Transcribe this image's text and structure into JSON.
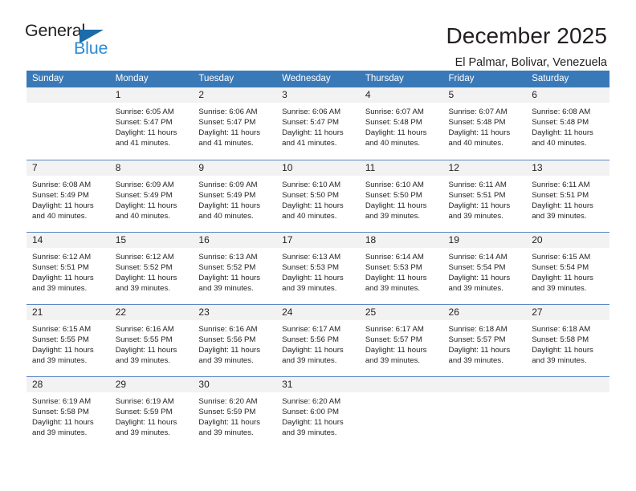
{
  "brand": {
    "name_top": "General",
    "name_bottom": "Blue",
    "triangle_color": "#1b6ca8",
    "bottom_color": "#2e8bd4"
  },
  "header": {
    "title": "December 2025",
    "location": "El Palmar, Bolivar, Venezuela"
  },
  "theme": {
    "header_row_bg": "#3a79b8",
    "daynum_bg": "#f2f2f2",
    "grid_line": "#5b87c5",
    "text": "#231f20"
  },
  "weekday_headers": [
    "Sunday",
    "Monday",
    "Tuesday",
    "Wednesday",
    "Thursday",
    "Friday",
    "Saturday"
  ],
  "labels": {
    "sunrise_prefix": "Sunrise:",
    "sunset_prefix": "Sunset:",
    "daylight_prefix": "Daylight:"
  },
  "weeks": [
    [
      {
        "day": "",
        "blank": true
      },
      {
        "day": "1",
        "sunrise": "Sunrise: 6:05 AM",
        "sunset": "Sunset: 5:47 PM",
        "daylight_1": "Daylight: 11 hours",
        "daylight_2": "and 41 minutes."
      },
      {
        "day": "2",
        "sunrise": "Sunrise: 6:06 AM",
        "sunset": "Sunset: 5:47 PM",
        "daylight_1": "Daylight: 11 hours",
        "daylight_2": "and 41 minutes."
      },
      {
        "day": "3",
        "sunrise": "Sunrise: 6:06 AM",
        "sunset": "Sunset: 5:47 PM",
        "daylight_1": "Daylight: 11 hours",
        "daylight_2": "and 41 minutes."
      },
      {
        "day": "4",
        "sunrise": "Sunrise: 6:07 AM",
        "sunset": "Sunset: 5:48 PM",
        "daylight_1": "Daylight: 11 hours",
        "daylight_2": "and 40 minutes."
      },
      {
        "day": "5",
        "sunrise": "Sunrise: 6:07 AM",
        "sunset": "Sunset: 5:48 PM",
        "daylight_1": "Daylight: 11 hours",
        "daylight_2": "and 40 minutes."
      },
      {
        "day": "6",
        "sunrise": "Sunrise: 6:08 AM",
        "sunset": "Sunset: 5:48 PM",
        "daylight_1": "Daylight: 11 hours",
        "daylight_2": "and 40 minutes."
      }
    ],
    [
      {
        "day": "7",
        "sunrise": "Sunrise: 6:08 AM",
        "sunset": "Sunset: 5:49 PM",
        "daylight_1": "Daylight: 11 hours",
        "daylight_2": "and 40 minutes."
      },
      {
        "day": "8",
        "sunrise": "Sunrise: 6:09 AM",
        "sunset": "Sunset: 5:49 PM",
        "daylight_1": "Daylight: 11 hours",
        "daylight_2": "and 40 minutes."
      },
      {
        "day": "9",
        "sunrise": "Sunrise: 6:09 AM",
        "sunset": "Sunset: 5:49 PM",
        "daylight_1": "Daylight: 11 hours",
        "daylight_2": "and 40 minutes."
      },
      {
        "day": "10",
        "sunrise": "Sunrise: 6:10 AM",
        "sunset": "Sunset: 5:50 PM",
        "daylight_1": "Daylight: 11 hours",
        "daylight_2": "and 40 minutes."
      },
      {
        "day": "11",
        "sunrise": "Sunrise: 6:10 AM",
        "sunset": "Sunset: 5:50 PM",
        "daylight_1": "Daylight: 11 hours",
        "daylight_2": "and 39 minutes."
      },
      {
        "day": "12",
        "sunrise": "Sunrise: 6:11 AM",
        "sunset": "Sunset: 5:51 PM",
        "daylight_1": "Daylight: 11 hours",
        "daylight_2": "and 39 minutes."
      },
      {
        "day": "13",
        "sunrise": "Sunrise: 6:11 AM",
        "sunset": "Sunset: 5:51 PM",
        "daylight_1": "Daylight: 11 hours",
        "daylight_2": "and 39 minutes."
      }
    ],
    [
      {
        "day": "14",
        "sunrise": "Sunrise: 6:12 AM",
        "sunset": "Sunset: 5:51 PM",
        "daylight_1": "Daylight: 11 hours",
        "daylight_2": "and 39 minutes."
      },
      {
        "day": "15",
        "sunrise": "Sunrise: 6:12 AM",
        "sunset": "Sunset: 5:52 PM",
        "daylight_1": "Daylight: 11 hours",
        "daylight_2": "and 39 minutes."
      },
      {
        "day": "16",
        "sunrise": "Sunrise: 6:13 AM",
        "sunset": "Sunset: 5:52 PM",
        "daylight_1": "Daylight: 11 hours",
        "daylight_2": "and 39 minutes."
      },
      {
        "day": "17",
        "sunrise": "Sunrise: 6:13 AM",
        "sunset": "Sunset: 5:53 PM",
        "daylight_1": "Daylight: 11 hours",
        "daylight_2": "and 39 minutes."
      },
      {
        "day": "18",
        "sunrise": "Sunrise: 6:14 AM",
        "sunset": "Sunset: 5:53 PM",
        "daylight_1": "Daylight: 11 hours",
        "daylight_2": "and 39 minutes."
      },
      {
        "day": "19",
        "sunrise": "Sunrise: 6:14 AM",
        "sunset": "Sunset: 5:54 PM",
        "daylight_1": "Daylight: 11 hours",
        "daylight_2": "and 39 minutes."
      },
      {
        "day": "20",
        "sunrise": "Sunrise: 6:15 AM",
        "sunset": "Sunset: 5:54 PM",
        "daylight_1": "Daylight: 11 hours",
        "daylight_2": "and 39 minutes."
      }
    ],
    [
      {
        "day": "21",
        "sunrise": "Sunrise: 6:15 AM",
        "sunset": "Sunset: 5:55 PM",
        "daylight_1": "Daylight: 11 hours",
        "daylight_2": "and 39 minutes."
      },
      {
        "day": "22",
        "sunrise": "Sunrise: 6:16 AM",
        "sunset": "Sunset: 5:55 PM",
        "daylight_1": "Daylight: 11 hours",
        "daylight_2": "and 39 minutes."
      },
      {
        "day": "23",
        "sunrise": "Sunrise: 6:16 AM",
        "sunset": "Sunset: 5:56 PM",
        "daylight_1": "Daylight: 11 hours",
        "daylight_2": "and 39 minutes."
      },
      {
        "day": "24",
        "sunrise": "Sunrise: 6:17 AM",
        "sunset": "Sunset: 5:56 PM",
        "daylight_1": "Daylight: 11 hours",
        "daylight_2": "and 39 minutes."
      },
      {
        "day": "25",
        "sunrise": "Sunrise: 6:17 AM",
        "sunset": "Sunset: 5:57 PM",
        "daylight_1": "Daylight: 11 hours",
        "daylight_2": "and 39 minutes."
      },
      {
        "day": "26",
        "sunrise": "Sunrise: 6:18 AM",
        "sunset": "Sunset: 5:57 PM",
        "daylight_1": "Daylight: 11 hours",
        "daylight_2": "and 39 minutes."
      },
      {
        "day": "27",
        "sunrise": "Sunrise: 6:18 AM",
        "sunset": "Sunset: 5:58 PM",
        "daylight_1": "Daylight: 11 hours",
        "daylight_2": "and 39 minutes."
      }
    ],
    [
      {
        "day": "28",
        "sunrise": "Sunrise: 6:19 AM",
        "sunset": "Sunset: 5:58 PM",
        "daylight_1": "Daylight: 11 hours",
        "daylight_2": "and 39 minutes."
      },
      {
        "day": "29",
        "sunrise": "Sunrise: 6:19 AM",
        "sunset": "Sunset: 5:59 PM",
        "daylight_1": "Daylight: 11 hours",
        "daylight_2": "and 39 minutes."
      },
      {
        "day": "30",
        "sunrise": "Sunrise: 6:20 AM",
        "sunset": "Sunset: 5:59 PM",
        "daylight_1": "Daylight: 11 hours",
        "daylight_2": "and 39 minutes."
      },
      {
        "day": "31",
        "sunrise": "Sunrise: 6:20 AM",
        "sunset": "Sunset: 6:00 PM",
        "daylight_1": "Daylight: 11 hours",
        "daylight_2": "and 39 minutes."
      },
      {
        "day": "",
        "blank": true
      },
      {
        "day": "",
        "blank": true
      },
      {
        "day": "",
        "blank": true
      }
    ]
  ]
}
